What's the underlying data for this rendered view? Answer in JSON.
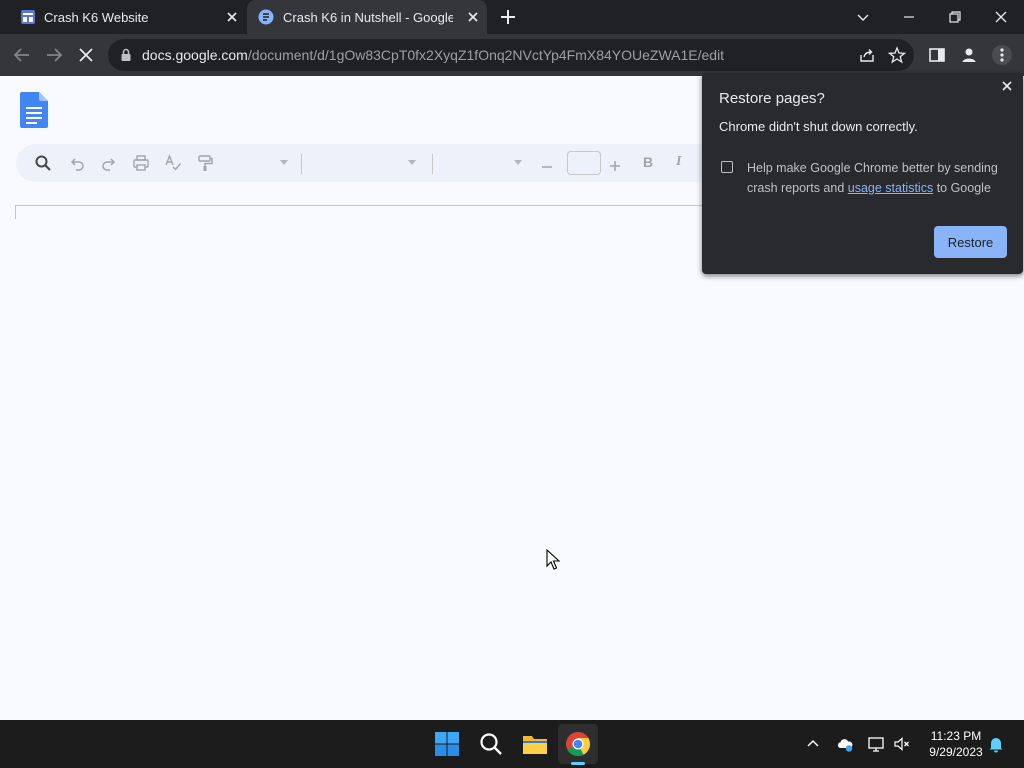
{
  "browser": {
    "tabs": [
      {
        "title": "Crash K6 Website",
        "favicon": "website-builder-icon",
        "active": false
      },
      {
        "title": "Crash K6 in Nutshell - Google Docs",
        "favicon": "google-docs-icon",
        "active": true
      }
    ],
    "new_tab_icon": "plus-icon",
    "url_host": "docs.google.com",
    "url_path": "/document/d/1gOw83CpT0fx2XyqZ1fOnq2NVctYp4FmX84YOUeZWA1E/edit",
    "page_state": "loading"
  },
  "docs_toolbar": {
    "tools": [
      "search-icon",
      "undo-icon",
      "redo-icon",
      "print-icon",
      "spellcheck-icon",
      "paint-format-icon",
      "font-size-decrease-icon",
      "font-size-increase-icon"
    ],
    "bold_label": "B",
    "italic_label": "I"
  },
  "restore_popup": {
    "title": "Restore pages?",
    "subtitle": "Chrome didn't shut down correctly.",
    "checkbox_checked": false,
    "checkbox_text_before": "Help make Google Chrome better by sending crash reports and ",
    "checkbox_link": "usage statistics",
    "checkbox_text_after": " to Google",
    "button_label": "Restore"
  },
  "taskbar": {
    "apps": [
      "windows-start-icon",
      "search-icon",
      "file-explorer-icon",
      "chrome-icon"
    ],
    "active_app": "chrome-icon",
    "tray": [
      "chevron-up-icon",
      "onedrive-icon",
      "network-icon",
      "volume-muted-icon",
      "notification-bell-icon"
    ],
    "time": "11:23 PM",
    "date": "9/29/2023"
  },
  "colors": {
    "chrome_dark": "#202124",
    "chrome_toolbar": "#35363a",
    "popup_bg": "#292a2d",
    "accent_blue": "#8ab4f8",
    "docs_bg": "#f8fafd",
    "docs_blue": "#4285f4",
    "taskbar_bg": "#1c1c1c"
  }
}
